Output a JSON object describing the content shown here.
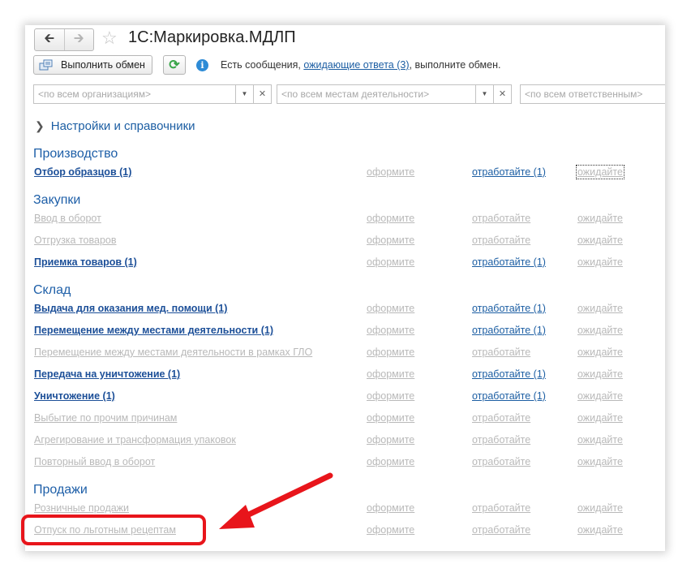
{
  "window": {
    "title": "1С:Маркировка.МДЛП",
    "back_icon": "arrow-left-icon",
    "forward_icon": "arrow-right-icon",
    "favorite_icon": "star-icon"
  },
  "toolbar": {
    "exchange_label": "Выполнить обмен",
    "message_prefix": "Есть сообщения, ",
    "message_link": "ожидающие ответа (3)",
    "message_suffix": ", выполните обмен."
  },
  "filters": {
    "organizations_placeholder": "<по всем организациям>",
    "places_placeholder": "<по всем местам деятельности>",
    "responsible_placeholder": "<по всем ответственным>"
  },
  "settings_label": "Настройки и справочники",
  "actions": {
    "issue": "оформите",
    "process": "отработайте",
    "wait": "ожидайте"
  },
  "sections": [
    {
      "title": "Производство",
      "rows": [
        {
          "name": "Отбор образцов (1)",
          "issue": "оформите",
          "process": "отработайте (1)",
          "wait": "ожидайте"
        }
      ]
    },
    {
      "title": "Закупки",
      "rows": [
        {
          "name": "Ввод в оборот",
          "issue": "оформите",
          "process": "отработайте",
          "wait": "ожидайте"
        },
        {
          "name": "Отгрузка товаров",
          "issue": "оформите",
          "process": "отработайте",
          "wait": "ожидайте"
        },
        {
          "name": "Приемка товаров (1)",
          "issue": "оформите",
          "process": "отработайте (1)",
          "wait": "ожидайте"
        }
      ]
    },
    {
      "title": "Склад",
      "rows": [
        {
          "name": "Выдача для оказания мед. помощи (1)",
          "issue": "оформите",
          "process": "отработайте (1)",
          "wait": "ожидайте"
        },
        {
          "name": "Перемещение между местами деятельности (1)",
          "issue": "оформите",
          "process": "отработайте (1)",
          "wait": "ожидайте"
        },
        {
          "name": "Перемещение между местами деятельности в рамках ГЛО",
          "issue": "оформите",
          "process": "отработайте",
          "wait": "ожидайте"
        },
        {
          "name": "Передача на уничтожение (1)",
          "issue": "оформите",
          "process": "отработайте (1)",
          "wait": "ожидайте"
        },
        {
          "name": "Уничтожение (1)",
          "issue": "оформите",
          "process": "отработайте (1)",
          "wait": "ожидайте"
        },
        {
          "name": "Выбытие по прочим причинам",
          "issue": "оформите",
          "process": "отработайте",
          "wait": "ожидайте"
        },
        {
          "name": "Агрегирование и трансформация упаковок",
          "issue": "оформите",
          "process": "отработайте",
          "wait": "ожидайте"
        },
        {
          "name": "Повторный ввод в оборот",
          "issue": "оформите",
          "process": "отработайте",
          "wait": "ожидайте"
        }
      ]
    },
    {
      "title": "Продажи",
      "rows": [
        {
          "name": "Розничные продажи",
          "issue": "оформите",
          "process": "отработайте",
          "wait": "ожидайте"
        },
        {
          "name": "Отпуск по льготным рецептам",
          "issue": "оформите",
          "process": "отработайте",
          "wait": "ожидайте"
        }
      ]
    }
  ],
  "colors": {
    "link_active": "#1c4f98",
    "link_disabled": "#b9b9b9",
    "section_title": "#1e5fa8",
    "annotation_red": "#e8151b"
  }
}
